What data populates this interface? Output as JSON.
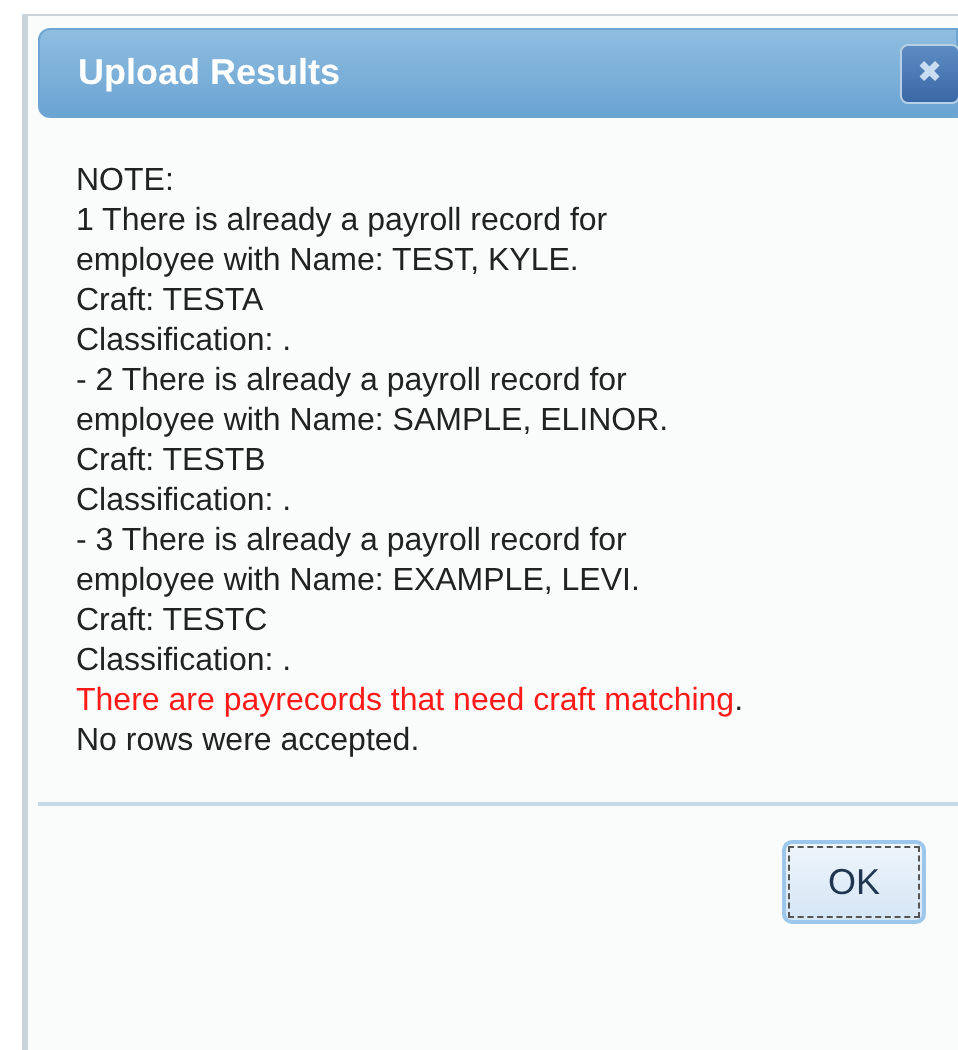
{
  "dialog": {
    "title": "Upload Results",
    "close_button": "✖",
    "lines": [
      {
        "segments": [
          {
            "text": "NOTE:",
            "alert": false
          }
        ]
      },
      {
        "segments": [
          {
            "text": "1 There is already a payroll record for",
            "alert": false
          }
        ]
      },
      {
        "segments": [
          {
            "text": "employee with Name: TEST, KYLE.",
            "alert": false
          }
        ]
      },
      {
        "segments": [
          {
            "text": "Craft: TESTA",
            "alert": false
          }
        ]
      },
      {
        "segments": [
          {
            "text": "Classification: .",
            "alert": false
          }
        ]
      },
      {
        "segments": [
          {
            "text": "- 2 There is already a payroll record for",
            "alert": false
          }
        ]
      },
      {
        "segments": [
          {
            "text": "employee with Name: SAMPLE, ELINOR.",
            "alert": false
          }
        ]
      },
      {
        "segments": [
          {
            "text": "Craft: TESTB",
            "alert": false
          }
        ]
      },
      {
        "segments": [
          {
            "text": "Classification: .",
            "alert": false
          }
        ]
      },
      {
        "segments": [
          {
            "text": "- 3 There is already a payroll record for",
            "alert": false
          }
        ]
      },
      {
        "segments": [
          {
            "text": "employee with Name: EXAMPLE, LEVI.",
            "alert": false
          }
        ]
      },
      {
        "segments": [
          {
            "text": "Craft: TESTC",
            "alert": false
          }
        ]
      },
      {
        "segments": [
          {
            "text": "Classification: .",
            "alert": false
          }
        ]
      },
      {
        "segments": [
          {
            "text": "There are payrecords that need craft matching",
            "alert": true
          },
          {
            "text": ".",
            "alert": false
          }
        ]
      },
      {
        "segments": [
          {
            "text": "No rows were accepted.",
            "alert": false
          }
        ]
      }
    ],
    "buttons": [
      {
        "label": "OK",
        "focused": true
      }
    ]
  }
}
